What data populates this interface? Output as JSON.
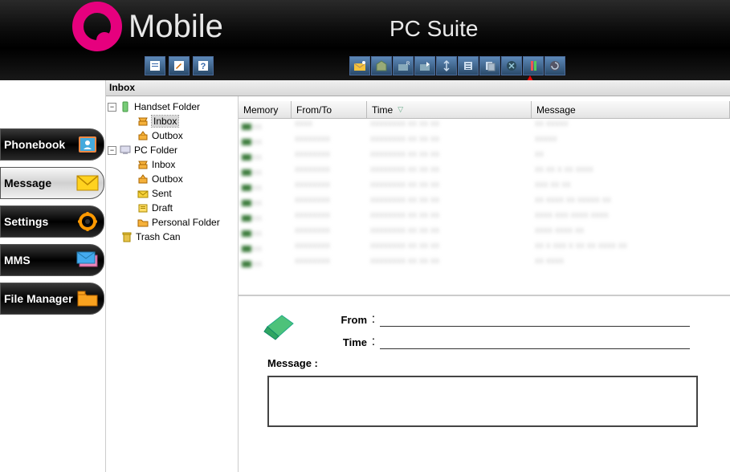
{
  "header": {
    "brand": "Mobile",
    "suite": "PC Suite"
  },
  "nav": [
    {
      "label": "Phonebook",
      "icon": "phonebook",
      "active": false
    },
    {
      "label": "Message",
      "icon": "message",
      "active": true
    },
    {
      "label": "Settings",
      "icon": "settings",
      "active": false
    },
    {
      "label": "MMS",
      "icon": "mms",
      "active": false
    },
    {
      "label": "File Manager",
      "icon": "filemanager",
      "active": false
    }
  ],
  "inbox_title": "Inbox",
  "tree": [
    {
      "label": "Handset Folder",
      "level": 0,
      "icon": "handset",
      "expand": "-"
    },
    {
      "label": "Inbox",
      "level": 2,
      "icon": "inbox",
      "selected": true
    },
    {
      "label": "Outbox",
      "level": 2,
      "icon": "outbox"
    },
    {
      "label": "PC Folder",
      "level": 0,
      "icon": "pc",
      "expand": "-"
    },
    {
      "label": "Inbox",
      "level": 2,
      "icon": "inbox"
    },
    {
      "label": "Outbox",
      "level": 2,
      "icon": "outbox"
    },
    {
      "label": "Sent",
      "level": 2,
      "icon": "sent"
    },
    {
      "label": "Draft",
      "level": 2,
      "icon": "draft"
    },
    {
      "label": "Personal Folder",
      "level": 2,
      "icon": "personal"
    },
    {
      "label": "Trash Can",
      "level": 1,
      "icon": "trash"
    }
  ],
  "columns": {
    "memory": "Memory",
    "fromto": "From/To",
    "time": "Time",
    "message": "Message"
  },
  "rows": [
    {
      "c2": "xxxx",
      "c3": "xxxxxxxx xx xx xx",
      "c4": "xx xxxxx"
    },
    {
      "c2": "xxxxxxxx",
      "c3": "xxxxxxxx xx xx xx",
      "c4": "xxxxx"
    },
    {
      "c2": "xxxxxxxx",
      "c3": "xxxxxxxx xx xx xx",
      "c4": "xx"
    },
    {
      "c2": "xxxxxxxx",
      "c3": "xxxxxxxx xx xx xx",
      "c4": "xx xx x xx xxxx"
    },
    {
      "c2": "xxxxxxxx",
      "c3": "xxxxxxxx xx xx xx",
      "c4": "xxx xx xx"
    },
    {
      "c2": "xxxxxxxx",
      "c3": "xxxxxxxx xx xx xx",
      "c4": "xx xxxx xx xxxxx xx"
    },
    {
      "c2": "xxxxxxxx",
      "c3": "xxxxxxxx xx xx xx",
      "c4": "xxxx xxx xxxx xxxx"
    },
    {
      "c2": "xxxxxxxx",
      "c3": "xxxxxxxx xx xx xx",
      "c4": "xxxx xxxx xx"
    },
    {
      "c2": "xxxxxxxx",
      "c3": "xxxxxxxx xx xx xx",
      "c4": "xx x xxx x xx xx xxxx xx"
    },
    {
      "c2": "xxxxxxxx",
      "c3": "xxxxxxxx xx xx xx",
      "c4": "xx xxxx"
    }
  ],
  "detail": {
    "from": "From",
    "time": "Time",
    "message": "Message :"
  }
}
